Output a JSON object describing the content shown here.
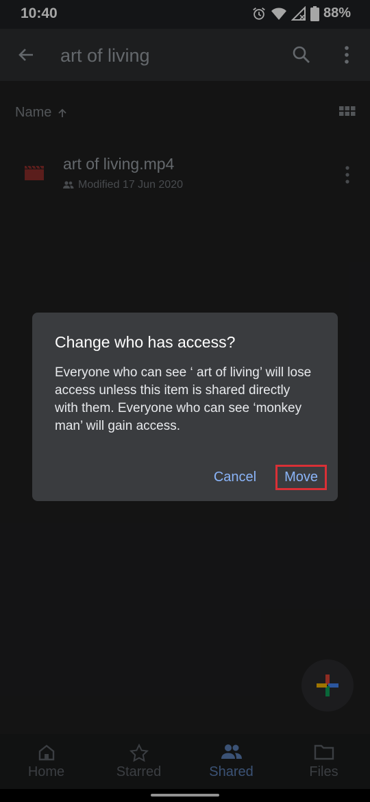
{
  "status_bar": {
    "time": "10:40",
    "battery": "88%",
    "icons": [
      "alarm-icon",
      "wifi-icon",
      "signal-icon",
      "battery-icon"
    ]
  },
  "top_bar": {
    "title": "art of living",
    "icons": [
      "back-arrow-icon",
      "search-icon",
      "more-vert-icon"
    ]
  },
  "sort_row": {
    "label": "Name",
    "icons": [
      "arrow-up-icon",
      "grid-view-icon"
    ]
  },
  "files": [
    {
      "name": "art of living.mp4",
      "meta": "Modified 17 Jun 2020",
      "icon": "video-file-icon",
      "icon_color": "#8c2f2c"
    }
  ],
  "dialog": {
    "title": "Change who has access?",
    "body": "Everyone who can see ‘ art of living’ will lose access unless this item is shared directly with them. Everyone who can see ‘monkey man’ will gain access.",
    "cancel_label": "Cancel",
    "move_label": "Move",
    "accent": "#8ab4f8",
    "highlight": "#d93036"
  },
  "fab": {
    "icon": "plus-icon"
  },
  "bottom_nav": {
    "items": [
      {
        "label": "Home",
        "icon": "home-icon",
        "active": false
      },
      {
        "label": "Starred",
        "icon": "star-icon",
        "active": false
      },
      {
        "label": "Shared",
        "icon": "people-icon",
        "active": true
      },
      {
        "label": "Files",
        "icon": "folder-icon",
        "active": false
      }
    ]
  }
}
